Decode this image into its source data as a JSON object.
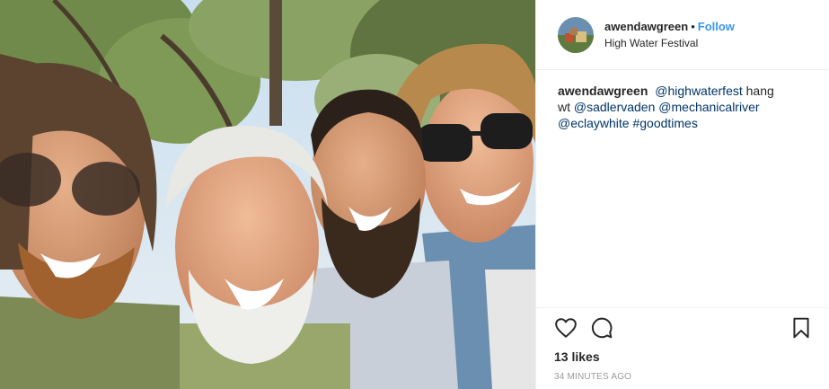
{
  "post": {
    "username": "awendawgreen",
    "separator": "•",
    "follow_label": "Follow",
    "location": "High Water Festival",
    "caption": {
      "username": "awendawgreen",
      "mention1": "@highwaterfest",
      "text1": "hang wt",
      "mention2": "@sadlervaden",
      "mention3": "@mechanicalriver",
      "mention4": "@eclaywhite",
      "hashtag": "#goodtimes"
    },
    "likes": "13 likes",
    "timestamp": "34 MINUTES AGO"
  },
  "icons": {
    "like": "heart-icon",
    "comment": "comment-icon",
    "save": "bookmark-icon"
  },
  "colors": {
    "follow": "#3897f0",
    "link": "#003569",
    "timestamp": "#999999",
    "divider": "#efefef"
  }
}
